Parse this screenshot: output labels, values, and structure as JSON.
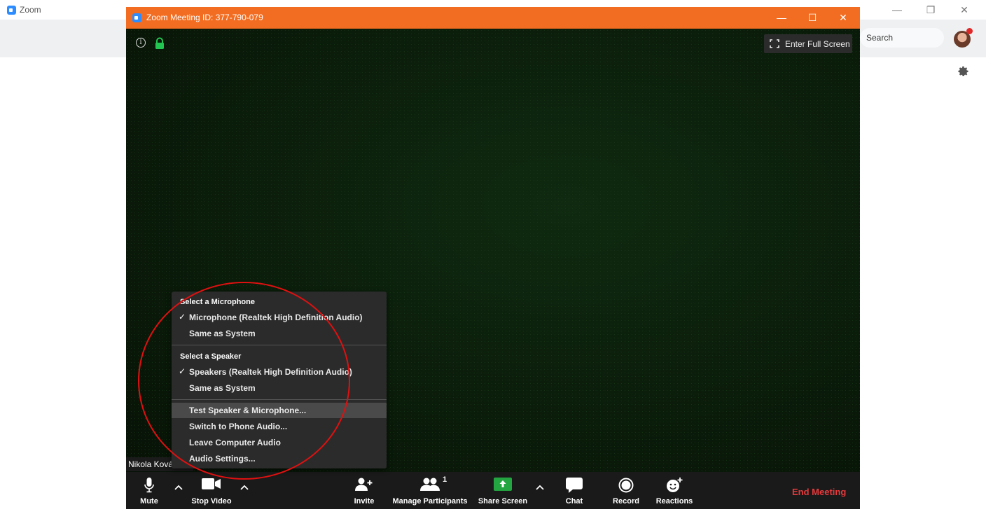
{
  "background_window": {
    "title": "Zoom",
    "search_placeholder": "Search",
    "controls": {
      "minimize": "—",
      "restore": "❐",
      "close": "✕"
    }
  },
  "meeting_window": {
    "title": "Zoom Meeting ID: 377-790-079",
    "controls": {
      "minimize": "—",
      "maximize": "☐",
      "close": "✕"
    },
    "fullscreen_label": "Enter Full Screen",
    "participant_name": "Nikola Kováčová"
  },
  "toolbar": {
    "mute": "Mute",
    "stop_video": "Stop Video",
    "invite": "Invite",
    "manage_participants": "Manage Participants",
    "participant_count": "1",
    "share_screen": "Share Screen",
    "chat": "Chat",
    "record": "Record",
    "reactions": "Reactions",
    "end_meeting": "End Meeting"
  },
  "audio_menu": {
    "mic_header": "Select a Microphone",
    "mic_items": [
      {
        "label": "Microphone (Realtek High Definition Audio)",
        "checked": true
      },
      {
        "label": "Same as System",
        "checked": false
      }
    ],
    "speaker_header": "Select a Speaker",
    "speaker_items": [
      {
        "label": "Speakers (Realtek High Definition Audio)",
        "checked": true
      },
      {
        "label": "Same as System",
        "checked": false
      }
    ],
    "actions": [
      {
        "label": "Test Speaker & Microphone...",
        "highlighted": true
      },
      {
        "label": "Switch to Phone Audio...",
        "highlighted": false
      },
      {
        "label": "Leave Computer Audio",
        "highlighted": false
      },
      {
        "label": "Audio Settings...",
        "highlighted": false
      }
    ],
    "check_glyph": "✓"
  },
  "colors": {
    "meeting_titlebar": "#f26d21",
    "end_meeting": "#e4393c",
    "share_screen": "#23a542",
    "annotation": "#e01010",
    "zoom_blue": "#2d8cff"
  }
}
